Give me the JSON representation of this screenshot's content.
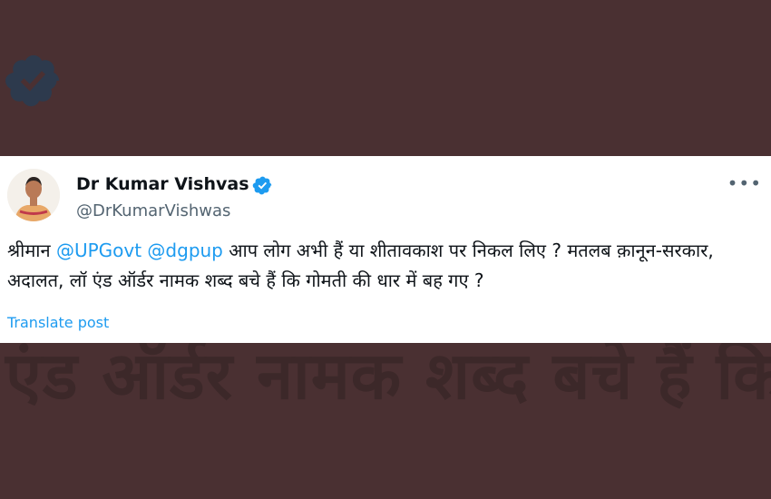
{
  "background": {
    "overlay_text": "एंड ऑर्डर नामक शब्द बचे हैं कि",
    "colors": {
      "bg": "#4a3032",
      "text": "#3c2829"
    }
  },
  "tweet": {
    "author": {
      "name": "Dr Kumar Vishvas",
      "handle": "@DrKumarVishwas",
      "verified_icon": "verified-badge-icon"
    },
    "more_icon": "more-options-icon",
    "more_label": "•••",
    "text": {
      "prefix": "श्रीमान ",
      "mention1": "@UPGovt",
      "sep": " ",
      "mention2": "@dgpup",
      "body": " आप लोग अभी हैं या शीतावकाश पर निकल लिए ? मतलब क़ानून-सरकार, अदालत, लॉ एंड ऑर्डर नामक शब्द बचे हैं कि गोमती की धार में बह गए ?"
    },
    "translate_label": "Translate post",
    "colors": {
      "link": "#1d9bf0",
      "text": "#0f1419",
      "secondary": "#536471"
    }
  }
}
